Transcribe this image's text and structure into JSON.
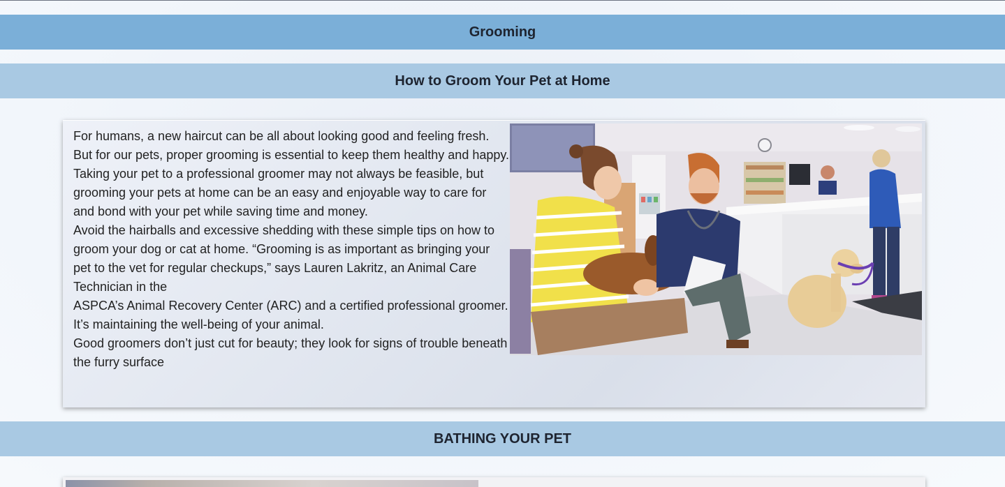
{
  "header": {
    "title": "Grooming"
  },
  "section1": {
    "title": "How to Groom Your Pet at Home",
    "paragraphs": [
      "For humans, a new haircut can be all about looking good and feeling fresh. But for our pets, proper grooming is essential to keep them healthy and happy.",
      "Taking your pet to a professional groomer may not always be feasible, but grooming your pets at home can be an easy and enjoyable way to care for and bond with your pet while saving time and money.",
      "Avoid the hairballs and excessive shedding with these simple tips on how to groom your dog or cat at home. “Grooming is as important as bringing your pet to the vet for regular checkups,” says Lauren Lakritz, an Animal Care Technician in the",
      "ASPCA’s Animal Recovery Center (ARC) and a certified professional groomer. It’s maintaining the well-being of your animal.",
      "Good groomers don’t just cut for beauty; they look for signs of trouble beneath the furry surface"
    ],
    "image": "vet-clinic-photo"
  },
  "section2": {
    "title": "BATHING YOUR PET",
    "image": "bathing-photo"
  },
  "colors": {
    "main_banner": "#7bafd8",
    "sub_banner": "#a9c9e3",
    "text": "#222222"
  }
}
